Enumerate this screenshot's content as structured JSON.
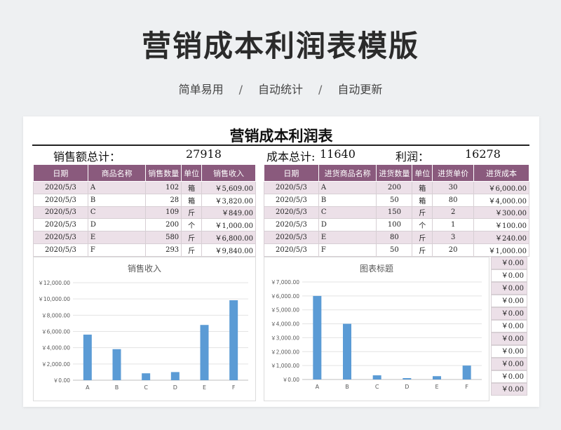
{
  "banner": {
    "title": "营销成本利润表模版",
    "tags": [
      "简单易用",
      "自动统计",
      "自动更新"
    ],
    "sep": "/"
  },
  "sheet": {
    "title": "营销成本利润表",
    "summary": {
      "sales_label": "销售额总计：",
      "sales_value": "27918",
      "cost_label": "成本总计:",
      "cost_value": "11640",
      "profit_label": "利润：",
      "profit_value": "16278"
    },
    "sales_table": {
      "headers": [
        "日期",
        "商品名称",
        "销售数量",
        "单位",
        "销售收入"
      ],
      "rows": [
        [
          "2020/5/3",
          "A",
          "102",
          "箱",
          "￥5,609.00"
        ],
        [
          "2020/5/3",
          "B",
          "28",
          "箱",
          "￥3,820.00"
        ],
        [
          "2020/5/3",
          "C",
          "109",
          "斤",
          "￥849.00"
        ],
        [
          "2020/5/3",
          "D",
          "200",
          "个",
          "￥1,000.00"
        ],
        [
          "2020/5/3",
          "E",
          "580",
          "斤",
          "￥6,800.00"
        ],
        [
          "2020/5/3",
          "F",
          "293",
          "斤",
          "￥9,840.00"
        ]
      ]
    },
    "purchase_table": {
      "headers": [
        "日期",
        "进货商品名称",
        "进货数量",
        "单位",
        "进货单价",
        "进货成本"
      ],
      "rows": [
        [
          "2020/5/3",
          "A",
          "200",
          "箱",
          "30",
          "￥6,000.00"
        ],
        [
          "2020/5/3",
          "B",
          "50",
          "箱",
          "80",
          "￥4,000.00"
        ],
        [
          "2020/5/3",
          "C",
          "150",
          "斤",
          "2",
          "￥300.00"
        ],
        [
          "2020/5/3",
          "D",
          "100",
          "个",
          "1",
          "￥100.00"
        ],
        [
          "2020/5/3",
          "E",
          "80",
          "斤",
          "3",
          "￥240.00"
        ],
        [
          "2020/5/3",
          "F",
          "50",
          "斤",
          "20",
          "￥1,000.00"
        ]
      ]
    },
    "side_values": [
      "￥0.00",
      "￥0.00",
      "￥0.00",
      "￥0.00",
      "￥0.00",
      "￥0.00",
      "￥0.00",
      "￥0.00",
      "￥0.00",
      "￥0.00",
      "￥0.00"
    ]
  },
  "chart_data": [
    {
      "type": "bar",
      "title": "销售收入",
      "categories": [
        "A",
        "B",
        "C",
        "D",
        "E",
        "F"
      ],
      "values": [
        5609,
        3820,
        849,
        1000,
        6800,
        9840
      ],
      "ylim": [
        0,
        12000
      ],
      "yticks": [
        0,
        2000,
        4000,
        6000,
        8000,
        10000,
        12000
      ],
      "ytick_labels": [
        "￥0.00",
        "￥2,000.00",
        "￥4,000.00",
        "￥6,000.00",
        "￥8,000.00",
        "￥10,000.00",
        "￥12,000.00"
      ],
      "grid": true,
      "color": "#5b9bd5"
    },
    {
      "type": "bar",
      "title": "图表标题",
      "categories": [
        "A",
        "B",
        "C",
        "D",
        "E",
        "F"
      ],
      "values": [
        6000,
        4000,
        300,
        100,
        240,
        1000
      ],
      "ylim": [
        0,
        7000
      ],
      "yticks": [
        0,
        1000,
        2000,
        3000,
        4000,
        5000,
        6000,
        7000
      ],
      "ytick_labels": [
        "￥0.00",
        "￥1,000.00",
        "￥2,000.00",
        "￥3,000.00",
        "￥4,000.00",
        "￥5,000.00",
        "￥6,000.00",
        "￥7,000.00"
      ],
      "grid": true,
      "color": "#5b9bd5"
    }
  ]
}
